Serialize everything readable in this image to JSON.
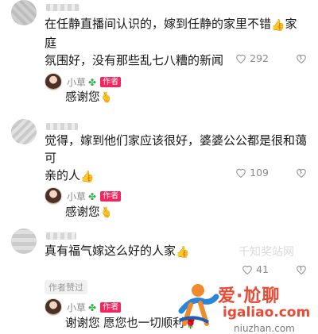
{
  "comments": [
    {
      "text_line1": "在任静直播间认识的，嫁到任静的家里不错",
      "emoji1": "👍",
      "text_line1_tail": "家庭",
      "text_line2": "氛围好，没有那些乱七八糟的新闻",
      "likes": "292"
    },
    {
      "text_line1": "觉得，嫁到他们家应该很好，婆婆公公都是很和蔼可",
      "text_line2": "亲的人",
      "emoji1": "👍",
      "likes": "109"
    },
    {
      "text_line1": "真有福气嫁这么好的人家",
      "emoji1": "👍",
      "likes": "41"
    }
  ],
  "replies": [
    {
      "name": "小草",
      "badge": "作者",
      "text": "感谢您",
      "emoji": "🫰"
    },
    {
      "name": "小草",
      "badge": "作者",
      "text": "感谢您",
      "emoji": "🫰"
    },
    {
      "name": "小草",
      "badge": "作者",
      "text": "谢谢您 愿您也一切顺利",
      "emoji": "🌹"
    }
  ],
  "liked_by_author": "作者赞过",
  "watermark": {
    "brand": "爱·尬聊",
    "site": "igaliao.com",
    "site2": "niuzhan.com",
    "faint": "千知奖站网"
  },
  "colors": {
    "badge": "#f3245e",
    "brand": "#e84b35"
  }
}
